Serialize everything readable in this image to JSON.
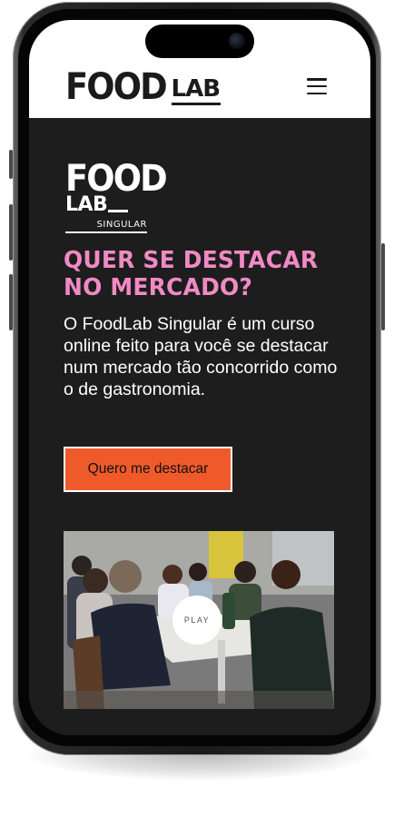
{
  "header": {
    "logo_food": "FOOD",
    "logo_lab": "LAB"
  },
  "hero": {
    "logo_food": "FOOD",
    "logo_lab": "LAB",
    "logo_singular": "SINGULAR",
    "headline": "QUER SE DESTACAR NO MERCADO?",
    "body": "O FoodLab Singular é um curso online feito para você se destacar num mercado tão concorrido como o de gastronomia.",
    "cta_label": "Quero me destacar"
  },
  "video": {
    "play_label": "PLAY"
  },
  "colors": {
    "accent_pink": "#f08ac4",
    "cta_orange": "#ef5a2b",
    "dark_bg": "#1d1d1d"
  },
  "icons": {
    "menu": "hamburger-icon",
    "play": "play-button"
  }
}
